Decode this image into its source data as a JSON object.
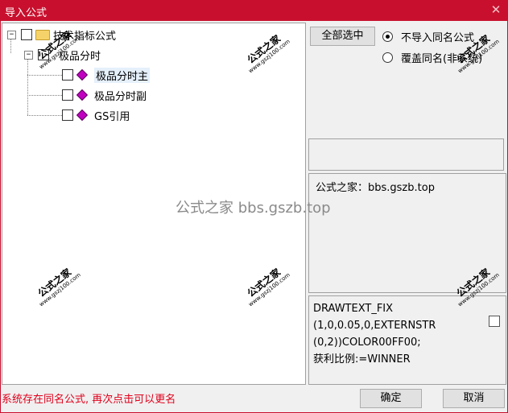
{
  "window": {
    "title": "导入公式",
    "close_glyph": "✕"
  },
  "tree": {
    "root": {
      "expander": "−",
      "label": "技术指标公式"
    },
    "group": {
      "expander": "−",
      "label": "极品分时"
    },
    "items": [
      {
        "label": "极品分时主"
      },
      {
        "label": "极品分时副"
      },
      {
        "label": "GS引用"
      }
    ]
  },
  "buttons": {
    "select_all": "全部选中",
    "ok": "确定",
    "cancel": "取消"
  },
  "options": {
    "skip_same_name": "不导入同名公式",
    "overwrite_same_name": "覆盖同名(非系统)"
  },
  "info_text": "公式之家：bbs.gszb.top",
  "code_lines": [
    "DRAWTEXT_FIX",
    "(1,0,0.05,0,EXTERNSTR",
    "(0,2))COLOR00FF00;",
    "获利比例:=WINNER"
  ],
  "status_message": "系统存在同名公式, 再次点击可以更名",
  "watermark": {
    "title": "公式之家",
    "url": "www.gszj100.com",
    "center": "公式之家 bbs.gszb.top"
  }
}
